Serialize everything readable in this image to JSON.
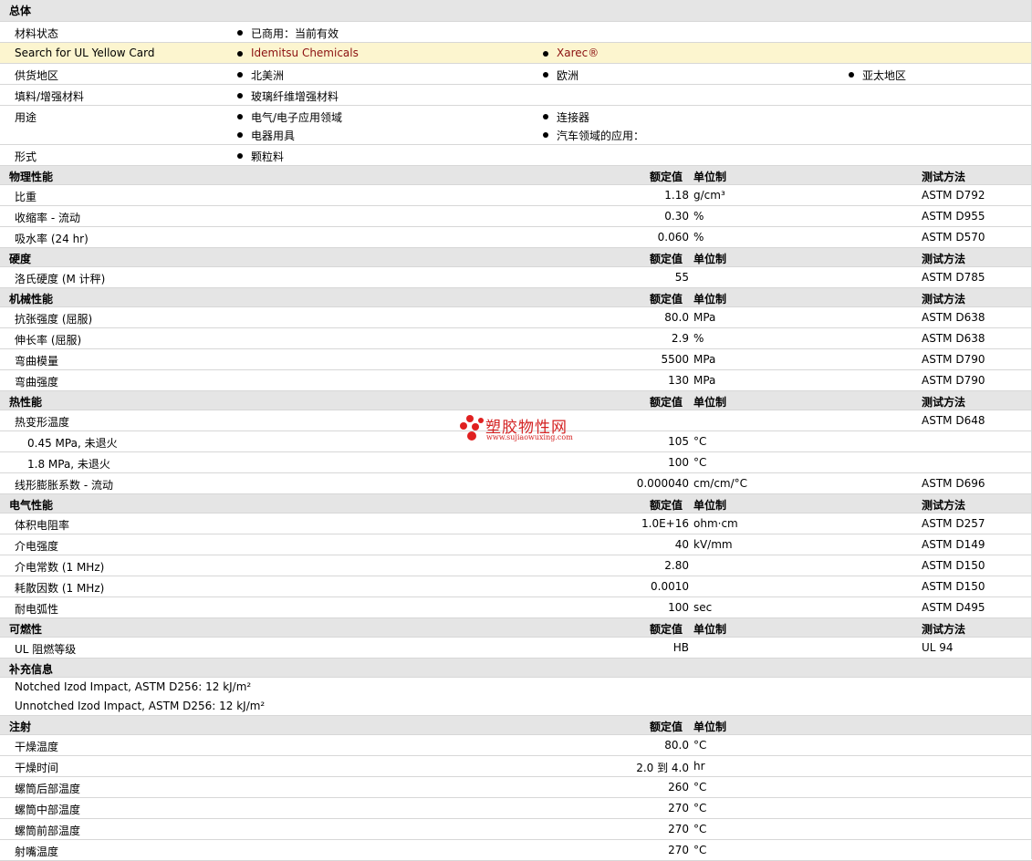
{
  "sections": {
    "general": "总体",
    "physical": "物理性能",
    "hardness": "硬度",
    "mechanical": "机械性能",
    "thermal": "热性能",
    "electrical": "电气性能",
    "flammability": "可燃性",
    "supplemental": "补充信息",
    "injection": "注射"
  },
  "headers": {
    "nominal": "额定值",
    "unit": "单位制",
    "method": "测试方法"
  },
  "general": {
    "status_label": "材料状态",
    "status_value": "已商用：当前有效",
    "ul_label": "Search for UL Yellow Card",
    "ul_links": [
      "Idemitsu Chemicals",
      "Xarec®"
    ],
    "availability_label": "供货地区",
    "availability": [
      "北美洲",
      "欧洲",
      "亚太地区"
    ],
    "filler_label": "填料/增强材料",
    "filler": "玻璃纤维增强材料",
    "uses_label": "用途",
    "uses": [
      "电气/电子应用领域",
      "连接器",
      "电器用具",
      "汽车领域的应用："
    ],
    "form_label": "形式",
    "form": "颗粒料"
  },
  "physical": [
    {
      "label": "比重",
      "value": "1.18",
      "unit": "g/cm³",
      "method": "ASTM D792"
    },
    {
      "label": "收缩率  - 流动",
      "value": "0.30",
      "unit": "%",
      "method": "ASTM D955"
    },
    {
      "label": "吸水率  (24 hr)",
      "value": "0.060",
      "unit": "%",
      "method": "ASTM D570"
    }
  ],
  "hardness": [
    {
      "label": "洛氏硬度  (M 计秤)",
      "value": "55",
      "unit": "",
      "method": "ASTM D785"
    }
  ],
  "mechanical": [
    {
      "label": "抗张强度  (屈服)",
      "value": "80.0",
      "unit": "MPa",
      "method": "ASTM D638"
    },
    {
      "label": "伸长率  (屈服)",
      "value": "2.9",
      "unit": "%",
      "method": "ASTM D638"
    },
    {
      "label": "弯曲模量",
      "value": "5500",
      "unit": "MPa",
      "method": "ASTM D790"
    },
    {
      "label": "弯曲强度",
      "value": "130",
      "unit": "MPa",
      "method": "ASTM D790"
    }
  ],
  "thermal": {
    "hdt_label": "热变形温度",
    "hdt_method": "ASTM D648",
    "hdt_rows": [
      {
        "label": "0.45 MPa, 未退火",
        "value": "105",
        "unit": "°C"
      },
      {
        "label": "1.8 MPa, 未退火",
        "value": "100",
        "unit": "°C"
      }
    ],
    "clte": {
      "label": "线形膨胀系数  - 流动",
      "value": "0.000040",
      "unit": "cm/cm/°C",
      "method": "ASTM D696"
    }
  },
  "electrical": [
    {
      "label": "体积电阻率",
      "value": "1.0E+16",
      "unit": "ohm·cm",
      "method": "ASTM D257"
    },
    {
      "label": "介电强度",
      "value": "40",
      "unit": "kV/mm",
      "method": "ASTM D149"
    },
    {
      "label": "介电常数  (1 MHz)",
      "value": "2.80",
      "unit": "",
      "method": "ASTM D150"
    },
    {
      "label": "耗散因数  (1 MHz)",
      "value": "0.0010",
      "unit": "",
      "method": "ASTM D150"
    },
    {
      "label": "耐电弧性",
      "value": "100",
      "unit": "sec",
      "method": "ASTM D495"
    }
  ],
  "flammability": [
    {
      "label": "UL 阻燃等级",
      "value": "HB",
      "unit": "",
      "method": "UL 94"
    }
  ],
  "supplemental": [
    "Notched Izod Impact, ASTM D256: 12 kJ/m²",
    "Unnotched Izod Impact, ASTM D256: 12 kJ/m²"
  ],
  "injection": [
    {
      "label": "干燥温度",
      "value": "80.0",
      "unit": "°C"
    },
    {
      "label": "干燥时间",
      "value": "2.0 到  4.0",
      "unit": "hr"
    },
    {
      "label": "螺筒后部温度",
      "value": "260",
      "unit": "°C"
    },
    {
      "label": "螺筒中部温度",
      "value": "270",
      "unit": "°C"
    },
    {
      "label": "螺筒前部温度",
      "value": "270",
      "unit": "°C"
    },
    {
      "label": "射嘴温度",
      "value": "270",
      "unit": "°C"
    }
  ],
  "watermark": {
    "cn": "塑胶物性网",
    "en": "www.sujiaowuxing.com",
    "color": "#d42323"
  }
}
